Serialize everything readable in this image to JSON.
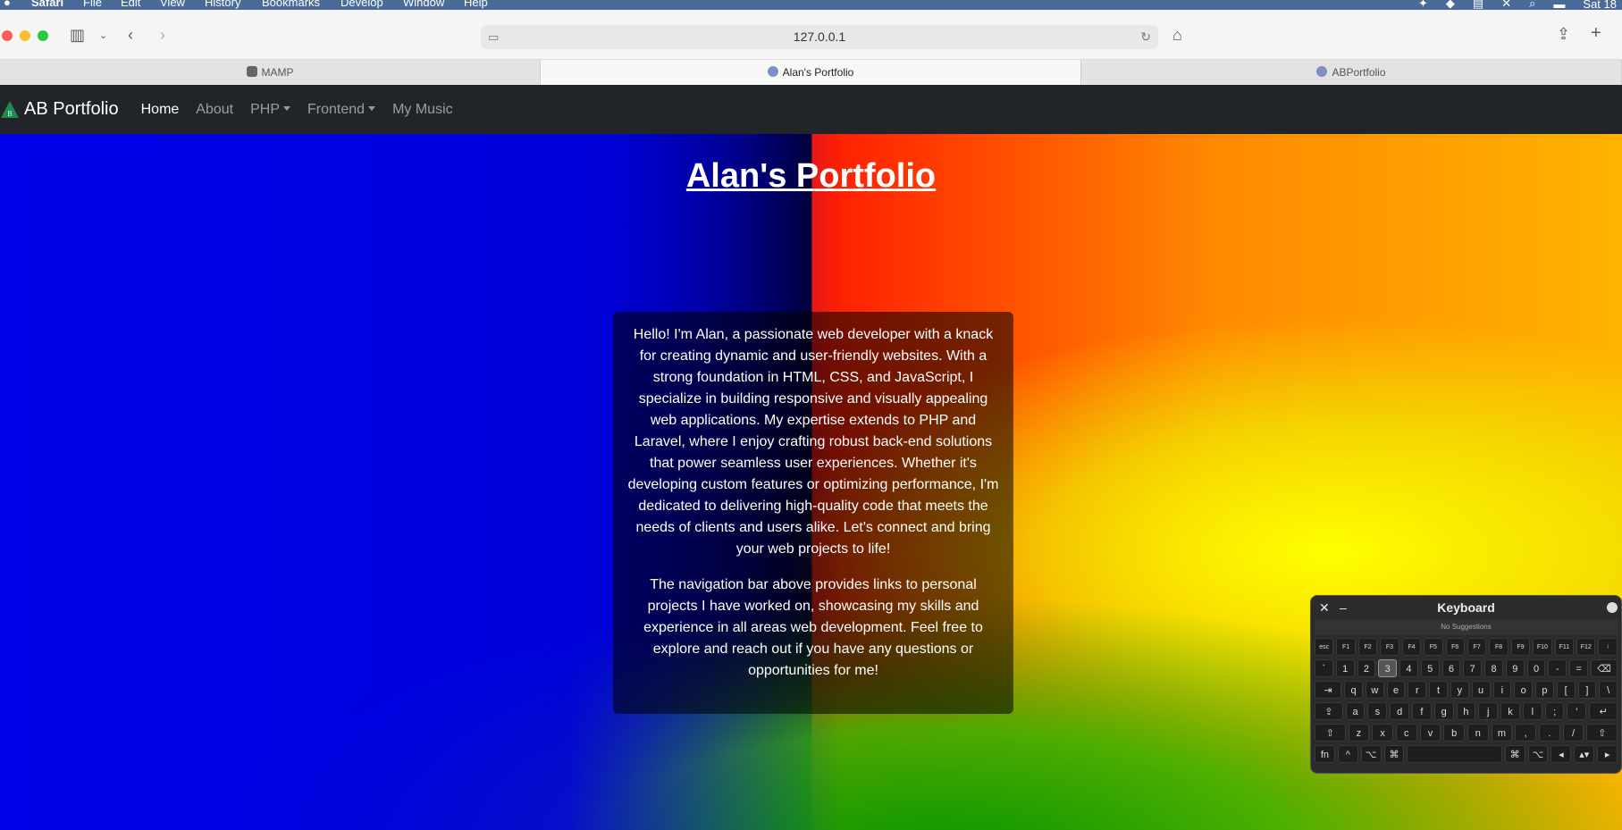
{
  "menubar": {
    "apple": "",
    "app_name": "Safari",
    "items": [
      "File",
      "Edit",
      "View",
      "History",
      "Bookmarks",
      "Develop",
      "Window",
      "Help"
    ],
    "clock": "Sat 18"
  },
  "toolbar": {
    "address": "127.0.0.1"
  },
  "tabs": [
    {
      "label": "MAMP"
    },
    {
      "label": "Alan's Portfolio"
    },
    {
      "label": "ABPortfolio"
    }
  ],
  "navbar": {
    "brand": "AB Portfolio",
    "links": [
      {
        "label": "Home"
      },
      {
        "label": "About"
      },
      {
        "label": "PHP"
      },
      {
        "label": "Frontend"
      },
      {
        "label": "My Music"
      }
    ]
  },
  "hero": {
    "title": "Alan's Portfolio",
    "paragraphs": [
      "Hello! I'm Alan, a passionate web developer with a knack for creating dynamic and user-friendly websites. With a strong foundation in HTML, CSS, and JavaScript, I specialize in building responsive and visually appealing web applications. My expertise extends to PHP and Laravel, where I enjoy crafting robust back-end solutions that power seamless user experiences. Whether it's developing custom features or optimizing performance, I'm dedicated to delivering high-quality code that meets the needs of clients and users alike. Let's connect and bring your web projects to life!",
      "The navigation bar above provides links to personal projects I have worked on, showcasing my skills and experience in all areas web development. Feel free to explore and reach out if you have any questions or opportunities for me!"
    ]
  },
  "keyboard": {
    "title": "Keyboard",
    "suggestions": "No Suggestions",
    "rows": [
      [
        "esc",
        "F1",
        "F2",
        "F3",
        "F4",
        "F5",
        "F6",
        "F7",
        "F8",
        "F9",
        "F10",
        "F11",
        "F12",
        "⁝"
      ],
      [
        "`",
        "1",
        "2",
        "3",
        "4",
        "5",
        "6",
        "7",
        "8",
        "9",
        "0",
        "-",
        "=",
        "⌫"
      ],
      [
        "⇥",
        "q",
        "w",
        "e",
        "r",
        "t",
        "y",
        "u",
        "i",
        "o",
        "p",
        "[",
        "]",
        "\\"
      ],
      [
        "⇪",
        "a",
        "s",
        "d",
        "f",
        "g",
        "h",
        "j",
        "k",
        "l",
        ";",
        "'",
        "↵"
      ],
      [
        "⇧",
        "z",
        "x",
        "c",
        "v",
        "b",
        "n",
        "m",
        ",",
        ".",
        "/",
        "⇧"
      ],
      [
        "fn",
        "^",
        "⌥",
        "⌘",
        "",
        "⌘",
        "⌥",
        "◂",
        "▴▾",
        "▸"
      ]
    ],
    "pressed_key": "3"
  },
  "colors": {
    "navbar_bg": "#212529",
    "gradient_blue": "#0000e6",
    "gradient_red": "#ff1a00",
    "gradient_yellow": "#ffff00",
    "gradient_green": "#00a000"
  }
}
